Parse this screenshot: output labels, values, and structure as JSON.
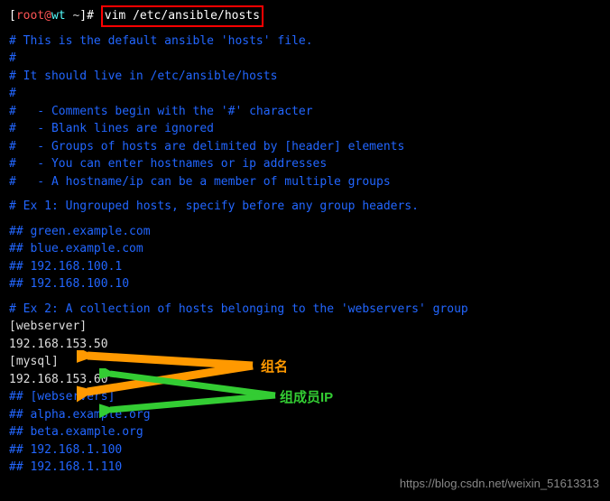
{
  "prompt": {
    "open_bracket": "[",
    "user": "root",
    "at": "@",
    "host": "wt",
    "space_path": " ~",
    "close_bracket": "]",
    "hash": "# ",
    "command": "vim /etc/ansible/hosts"
  },
  "comments": {
    "c0": "# This is the default ansible 'hosts' file.",
    "c1": "#",
    "c2": "# It should live in /etc/ansible/hosts",
    "c3": "#",
    "c4": "#   - Comments begin with the '#' character",
    "c5": "#   - Blank lines are ignored",
    "c6": "#   - Groups of hosts are delimited by [header] elements",
    "c7": "#   - You can enter hostnames or ip addresses",
    "c8": "#   - A hostname/ip can be a member of multiple groups",
    "c9": "# Ex 1: Ungrouped hosts, specify before any group headers.",
    "c10": "## green.example.com",
    "c11": "## blue.example.com",
    "c12": "## 192.168.100.1",
    "c13": "## 192.168.100.10",
    "c14": "# Ex 2: A collection of hosts belonging to the 'webservers' group",
    "c15": "## [webservers]",
    "c16": "## alpha.example.org",
    "c17": "## beta.example.org",
    "c18": "## 192.168.1.100",
    "c19": "## 192.168.1.110"
  },
  "entries": {
    "grp1": "[webserver]",
    "ip1": "192.168.153.50",
    "grp2": "[mysql]",
    "ip2": "192.168.153.60"
  },
  "annotations": {
    "group_name": "组名",
    "member_ip": "组成员IP"
  },
  "watermark": "https://blog.csdn.net/weixin_51613313"
}
